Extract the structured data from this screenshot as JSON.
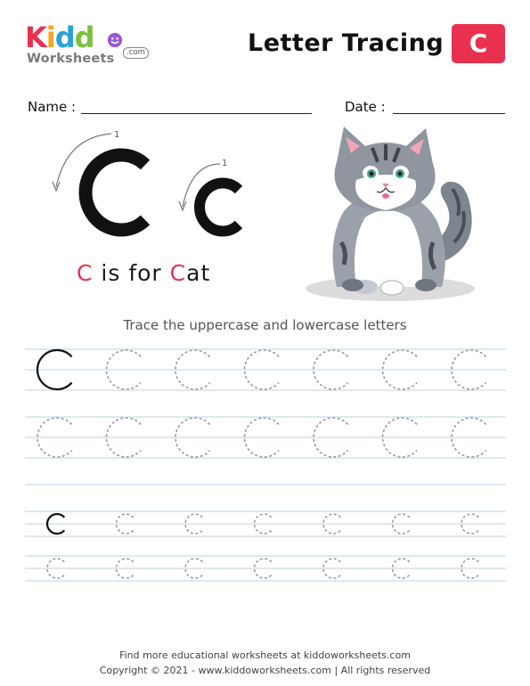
{
  "header": {
    "logo": {
      "brand": "Kiddo",
      "subtitle": "Worksheets",
      "domain": ".com"
    },
    "title": "Letter Tracing",
    "letter_badge": "C"
  },
  "form": {
    "name_label": "Name :",
    "date_label": "Date :"
  },
  "showcase": {
    "uppercase": "C",
    "lowercase": "c",
    "stroke_order_upper": "1",
    "stroke_order_lower": "1",
    "slogan": {
      "letter1": "C",
      "middle": " is for ",
      "letter2": "C",
      "rest": "at"
    },
    "image": "cat-illustration"
  },
  "instruction": "Trace the uppercase and lowercase letters",
  "practice": {
    "uppercase_rows": 2,
    "lowercase_rows": 2,
    "letters_per_row": 7,
    "uppercase_letter": "C",
    "lowercase_letter": "c"
  },
  "footer": {
    "line1": "Find more educational worksheets at kiddoworksheets.com",
    "line2": "Copyright © 2021 - www.kiddoworksheets.com  |  All rights reserved"
  },
  "colors": {
    "accent": "#e8314f",
    "guide_line": "#b9d3ea",
    "trace": "#9a9a9a"
  }
}
